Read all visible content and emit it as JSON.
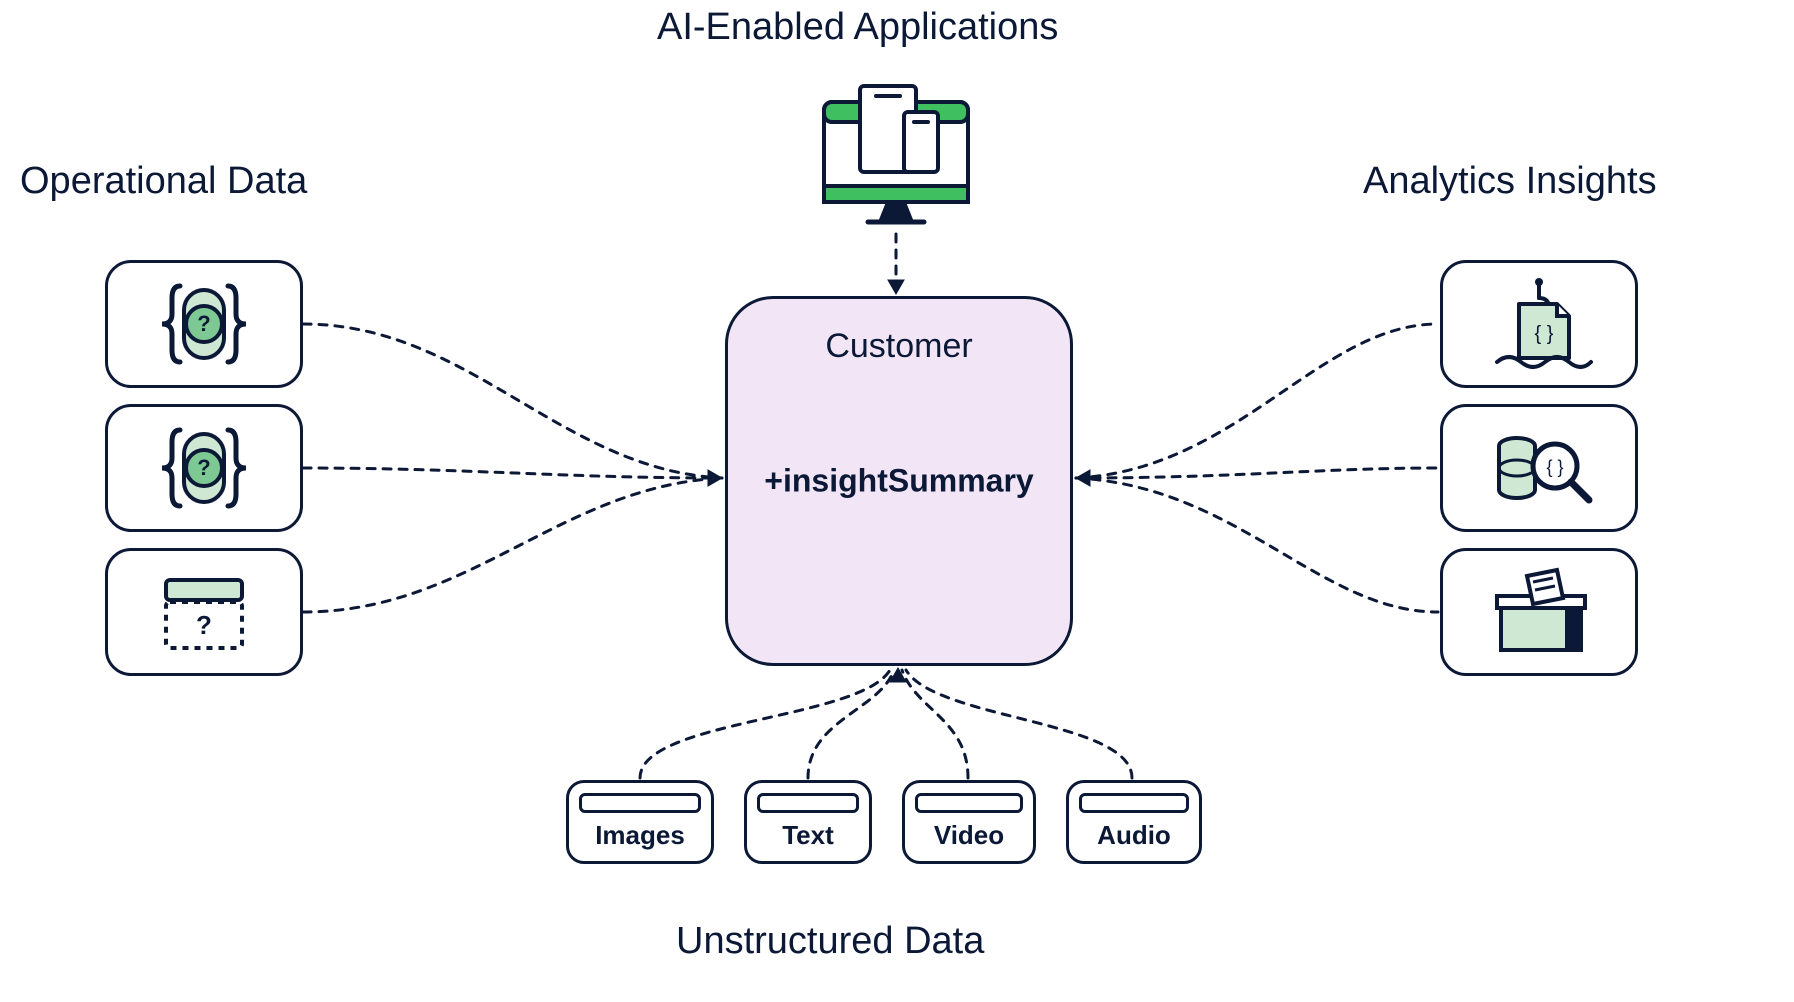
{
  "headings": {
    "top": "AI-Enabled Applications",
    "left": "Operational Data",
    "right": "Analytics Insights",
    "bottom": "Unstructured Data"
  },
  "center": {
    "title": "Customer",
    "main": "+insightSummary"
  },
  "unstructured": {
    "items": [
      "Images",
      "Text",
      "Video",
      "Audio"
    ]
  },
  "operational": {
    "icons": [
      "json-query-icon",
      "json-query-icon",
      "window-query-icon"
    ]
  },
  "analytics": {
    "icons": [
      "fishing-json-icon",
      "magnifier-db-icon",
      "archive-box-icon"
    ]
  },
  "colors": {
    "accent": "#3fbf60",
    "accent_fill": "#cfe8d4",
    "stroke": "#0b1836",
    "center_fill": "#f2e6f6"
  }
}
